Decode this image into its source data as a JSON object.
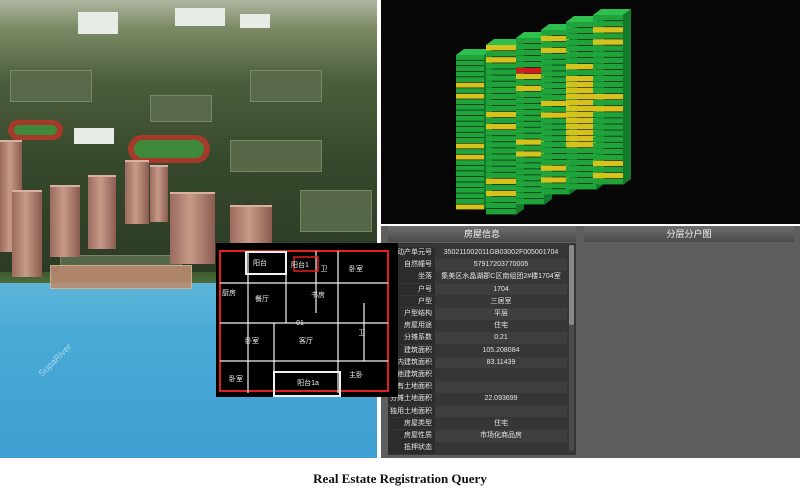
{
  "city_view": {
    "water_label": "SupaRiver"
  },
  "panel": {
    "info_header": "房屋信息",
    "floorplan_header": "分层分户图",
    "info_rows": [
      {
        "label": "不动产单元号",
        "value": "350211002011GB03002F005001704"
      },
      {
        "label": "自然幢号",
        "value": "57917203770005"
      },
      {
        "label": "坐落",
        "value": "集美区水晶湖郡C区南组团2#楼1704室"
      },
      {
        "label": "户号",
        "value": "1704"
      },
      {
        "label": "户型",
        "value": "三居室"
      },
      {
        "label": "户型结构",
        "value": "平层"
      },
      {
        "label": "房屋用途",
        "value": "住宅"
      },
      {
        "label": "分摊系数",
        "value": "0.21"
      },
      {
        "label": "建筑面积",
        "value": "105.208084"
      },
      {
        "label": "套内建筑面积",
        "value": "83.11439"
      },
      {
        "label": "其他建筑面积",
        "value": ""
      },
      {
        "label": "共有土地面积",
        "value": ""
      },
      {
        "label": "分摊土地面积",
        "value": "22.093699"
      },
      {
        "label": "独用土地面积",
        "value": ""
      },
      {
        "label": "房屋类型",
        "value": "住宅"
      },
      {
        "label": "房屋性质",
        "value": "市场化商品房"
      },
      {
        "label": "抵押状态",
        "value": ""
      }
    ],
    "rooms": [
      {
        "name": "阳台"
      },
      {
        "name": "阳台1"
      },
      {
        "name": "卫"
      },
      {
        "name": "卧室"
      },
      {
        "name": "厨房"
      },
      {
        "name": "餐厅"
      },
      {
        "name": "书房"
      },
      {
        "name": "卫"
      },
      {
        "name": "卧室"
      },
      {
        "name": "客厅"
      },
      {
        "name": "主卧"
      },
      {
        "name": "卧室"
      },
      {
        "name": "阳台1a"
      },
      {
        "name": "01"
      }
    ]
  },
  "caption": "Real Estate Registration Query",
  "colors": {
    "stack_green": "#1fa33a",
    "stack_yellow": "#d6c21c",
    "stack_red": "#d11d1d",
    "plan_red": "#e0201d",
    "plan_white": "#f2f2f2"
  }
}
